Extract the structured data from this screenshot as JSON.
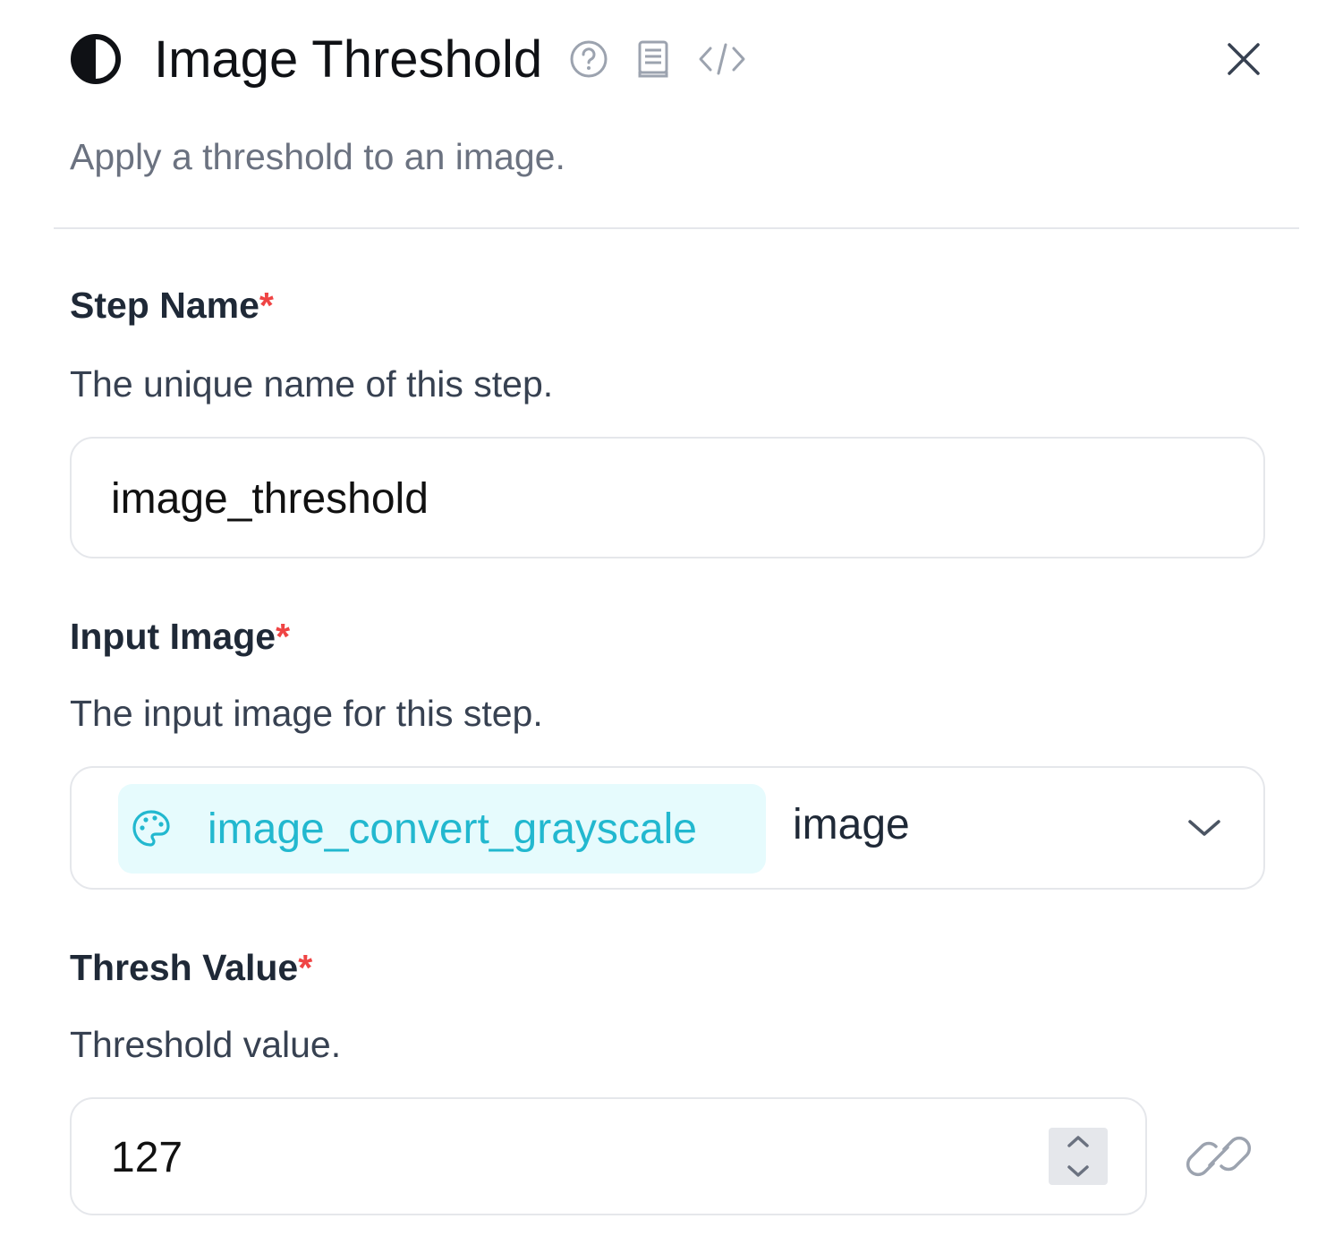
{
  "header": {
    "title": "Image Threshold",
    "subtitle": "Apply a threshold to an image.",
    "icons": [
      "threshold-icon",
      "help-icon",
      "docs-icon",
      "code-icon",
      "close-icon"
    ]
  },
  "fields": {
    "step_name": {
      "label": "Step Name",
      "required_mark": "*",
      "description": "The unique name of this step.",
      "value": "image_threshold"
    },
    "input_image": {
      "label": "Input Image",
      "required_mark": "*",
      "description": "The input image for this step.",
      "chip_label": "image_convert_grayscale",
      "chip_icon": "palette-icon",
      "selected_output": "image"
    },
    "thresh_value": {
      "label": "Thresh Value",
      "required_mark": "*",
      "description": "Threshold value.",
      "value": "127",
      "link_icon": "link-icon"
    }
  },
  "colors": {
    "accent_chip_bg": "#e6fbfd",
    "accent_chip_text": "#22b8cf",
    "required": "#ef4444",
    "muted": "#6b7280",
    "border": "#e5e7eb"
  }
}
